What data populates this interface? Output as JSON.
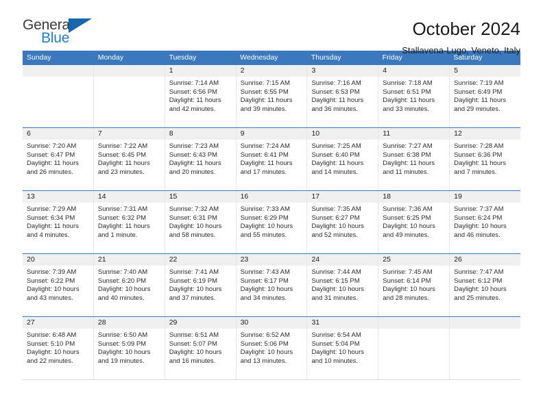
{
  "brand": {
    "name_part1": "General",
    "name_part2": "Blue",
    "triangle_color": "#1766ad",
    "blue_color": "#1f7fc4"
  },
  "header": {
    "title": "October 2024",
    "subtitle": "Stallavena-Lugo, Veneto, Italy"
  },
  "theme": {
    "header_bg": "#3b78bd",
    "day_number_bg": "#f0f0f0",
    "cell_bg": "#ffffff",
    "rule_color": "#3b78bd"
  },
  "weekdays": [
    "Sunday",
    "Monday",
    "Tuesday",
    "Wednesday",
    "Thursday",
    "Friday",
    "Saturday"
  ],
  "weeks": [
    {
      "days": [
        {
          "number": "",
          "empty": true,
          "sunrise": "",
          "sunset": "",
          "daylight_line1": "",
          "daylight_line2": ""
        },
        {
          "number": "",
          "empty": true,
          "sunrise": "",
          "sunset": "",
          "daylight_line1": "",
          "daylight_line2": ""
        },
        {
          "number": "1",
          "empty": false,
          "sunrise": "Sunrise: 7:14 AM",
          "sunset": "Sunset: 6:56 PM",
          "daylight_line1": "Daylight: 11 hours",
          "daylight_line2": "and 42 minutes."
        },
        {
          "number": "2",
          "empty": false,
          "sunrise": "Sunrise: 7:15 AM",
          "sunset": "Sunset: 6:55 PM",
          "daylight_line1": "Daylight: 11 hours",
          "daylight_line2": "and 39 minutes."
        },
        {
          "number": "3",
          "empty": false,
          "sunrise": "Sunrise: 7:16 AM",
          "sunset": "Sunset: 6:53 PM",
          "daylight_line1": "Daylight: 11 hours",
          "daylight_line2": "and 36 minutes."
        },
        {
          "number": "4",
          "empty": false,
          "sunrise": "Sunrise: 7:18 AM",
          "sunset": "Sunset: 6:51 PM",
          "daylight_line1": "Daylight: 11 hours",
          "daylight_line2": "and 33 minutes."
        },
        {
          "number": "5",
          "empty": false,
          "sunrise": "Sunrise: 7:19 AM",
          "sunset": "Sunset: 6:49 PM",
          "daylight_line1": "Daylight: 11 hours",
          "daylight_line2": "and 29 minutes."
        }
      ]
    },
    {
      "days": [
        {
          "number": "6",
          "empty": false,
          "sunrise": "Sunrise: 7:20 AM",
          "sunset": "Sunset: 6:47 PM",
          "daylight_line1": "Daylight: 11 hours",
          "daylight_line2": "and 26 minutes."
        },
        {
          "number": "7",
          "empty": false,
          "sunrise": "Sunrise: 7:22 AM",
          "sunset": "Sunset: 6:45 PM",
          "daylight_line1": "Daylight: 11 hours",
          "daylight_line2": "and 23 minutes."
        },
        {
          "number": "8",
          "empty": false,
          "sunrise": "Sunrise: 7:23 AM",
          "sunset": "Sunset: 6:43 PM",
          "daylight_line1": "Daylight: 11 hours",
          "daylight_line2": "and 20 minutes."
        },
        {
          "number": "9",
          "empty": false,
          "sunrise": "Sunrise: 7:24 AM",
          "sunset": "Sunset: 6:41 PM",
          "daylight_line1": "Daylight: 11 hours",
          "daylight_line2": "and 17 minutes."
        },
        {
          "number": "10",
          "empty": false,
          "sunrise": "Sunrise: 7:25 AM",
          "sunset": "Sunset: 6:40 PM",
          "daylight_line1": "Daylight: 11 hours",
          "daylight_line2": "and 14 minutes."
        },
        {
          "number": "11",
          "empty": false,
          "sunrise": "Sunrise: 7:27 AM",
          "sunset": "Sunset: 6:38 PM",
          "daylight_line1": "Daylight: 11 hours",
          "daylight_line2": "and 11 minutes."
        },
        {
          "number": "12",
          "empty": false,
          "sunrise": "Sunrise: 7:28 AM",
          "sunset": "Sunset: 6:36 PM",
          "daylight_line1": "Daylight: 11 hours",
          "daylight_line2": "and 7 minutes."
        }
      ]
    },
    {
      "days": [
        {
          "number": "13",
          "empty": false,
          "sunrise": "Sunrise: 7:29 AM",
          "sunset": "Sunset: 6:34 PM",
          "daylight_line1": "Daylight: 11 hours",
          "daylight_line2": "and 4 minutes."
        },
        {
          "number": "14",
          "empty": false,
          "sunrise": "Sunrise: 7:31 AM",
          "sunset": "Sunset: 6:32 PM",
          "daylight_line1": "Daylight: 11 hours",
          "daylight_line2": "and 1 minute."
        },
        {
          "number": "15",
          "empty": false,
          "sunrise": "Sunrise: 7:32 AM",
          "sunset": "Sunset: 6:31 PM",
          "daylight_line1": "Daylight: 10 hours",
          "daylight_line2": "and 58 minutes."
        },
        {
          "number": "16",
          "empty": false,
          "sunrise": "Sunrise: 7:33 AM",
          "sunset": "Sunset: 6:29 PM",
          "daylight_line1": "Daylight: 10 hours",
          "daylight_line2": "and 55 minutes."
        },
        {
          "number": "17",
          "empty": false,
          "sunrise": "Sunrise: 7:35 AM",
          "sunset": "Sunset: 6:27 PM",
          "daylight_line1": "Daylight: 10 hours",
          "daylight_line2": "and 52 minutes."
        },
        {
          "number": "18",
          "empty": false,
          "sunrise": "Sunrise: 7:36 AM",
          "sunset": "Sunset: 6:25 PM",
          "daylight_line1": "Daylight: 10 hours",
          "daylight_line2": "and 49 minutes."
        },
        {
          "number": "19",
          "empty": false,
          "sunrise": "Sunrise: 7:37 AM",
          "sunset": "Sunset: 6:24 PM",
          "daylight_line1": "Daylight: 10 hours",
          "daylight_line2": "and 46 minutes."
        }
      ]
    },
    {
      "days": [
        {
          "number": "20",
          "empty": false,
          "sunrise": "Sunrise: 7:39 AM",
          "sunset": "Sunset: 6:22 PM",
          "daylight_line1": "Daylight: 10 hours",
          "daylight_line2": "and 43 minutes."
        },
        {
          "number": "21",
          "empty": false,
          "sunrise": "Sunrise: 7:40 AM",
          "sunset": "Sunset: 6:20 PM",
          "daylight_line1": "Daylight: 10 hours",
          "daylight_line2": "and 40 minutes."
        },
        {
          "number": "22",
          "empty": false,
          "sunrise": "Sunrise: 7:41 AM",
          "sunset": "Sunset: 6:19 PM",
          "daylight_line1": "Daylight: 10 hours",
          "daylight_line2": "and 37 minutes."
        },
        {
          "number": "23",
          "empty": false,
          "sunrise": "Sunrise: 7:43 AM",
          "sunset": "Sunset: 6:17 PM",
          "daylight_line1": "Daylight: 10 hours",
          "daylight_line2": "and 34 minutes."
        },
        {
          "number": "24",
          "empty": false,
          "sunrise": "Sunrise: 7:44 AM",
          "sunset": "Sunset: 6:15 PM",
          "daylight_line1": "Daylight: 10 hours",
          "daylight_line2": "and 31 minutes."
        },
        {
          "number": "25",
          "empty": false,
          "sunrise": "Sunrise: 7:45 AM",
          "sunset": "Sunset: 6:14 PM",
          "daylight_line1": "Daylight: 10 hours",
          "daylight_line2": "and 28 minutes."
        },
        {
          "number": "26",
          "empty": false,
          "sunrise": "Sunrise: 7:47 AM",
          "sunset": "Sunset: 6:12 PM",
          "daylight_line1": "Daylight: 10 hours",
          "daylight_line2": "and 25 minutes."
        }
      ]
    },
    {
      "days": [
        {
          "number": "27",
          "empty": false,
          "sunrise": "Sunrise: 6:48 AM",
          "sunset": "Sunset: 5:10 PM",
          "daylight_line1": "Daylight: 10 hours",
          "daylight_line2": "and 22 minutes."
        },
        {
          "number": "28",
          "empty": false,
          "sunrise": "Sunrise: 6:50 AM",
          "sunset": "Sunset: 5:09 PM",
          "daylight_line1": "Daylight: 10 hours",
          "daylight_line2": "and 19 minutes."
        },
        {
          "number": "29",
          "empty": false,
          "sunrise": "Sunrise: 6:51 AM",
          "sunset": "Sunset: 5:07 PM",
          "daylight_line1": "Daylight: 10 hours",
          "daylight_line2": "and 16 minutes."
        },
        {
          "number": "30",
          "empty": false,
          "sunrise": "Sunrise: 6:52 AM",
          "sunset": "Sunset: 5:06 PM",
          "daylight_line1": "Daylight: 10 hours",
          "daylight_line2": "and 13 minutes."
        },
        {
          "number": "31",
          "empty": false,
          "sunrise": "Sunrise: 6:54 AM",
          "sunset": "Sunset: 5:04 PM",
          "daylight_line1": "Daylight: 10 hours",
          "daylight_line2": "and 10 minutes."
        },
        {
          "number": "",
          "empty": true,
          "sunrise": "",
          "sunset": "",
          "daylight_line1": "",
          "daylight_line2": ""
        },
        {
          "number": "",
          "empty": true,
          "sunrise": "",
          "sunset": "",
          "daylight_line1": "",
          "daylight_line2": ""
        }
      ]
    }
  ]
}
